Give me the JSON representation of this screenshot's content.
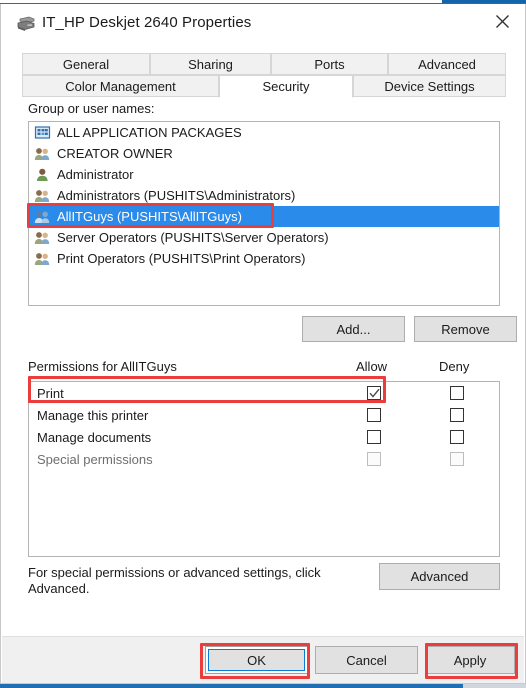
{
  "window": {
    "title": "IT_HP Deskjet 2640 Properties",
    "icon": "printer-icon",
    "close_label": "✕"
  },
  "tabs": {
    "row1": [
      {
        "label": "General",
        "active": false
      },
      {
        "label": "Sharing",
        "active": false
      },
      {
        "label": "Ports",
        "active": false
      },
      {
        "label": "Advanced",
        "active": false
      }
    ],
    "row2": [
      {
        "label": "Color Management",
        "active": false
      },
      {
        "label": "Security",
        "active": true
      },
      {
        "label": "Device Settings",
        "active": false
      }
    ]
  },
  "security": {
    "group_label": "Group or user names:",
    "groups": [
      {
        "name": "ALL APPLICATION PACKAGES",
        "icon": "application-packages-icon",
        "selected": false
      },
      {
        "name": "CREATOR OWNER",
        "icon": "group-icon",
        "selected": false
      },
      {
        "name": "Administrator",
        "icon": "user-icon",
        "selected": false
      },
      {
        "name": "Administrators (PUSHITS\\Administrators)",
        "icon": "group-icon",
        "selected": false
      },
      {
        "name": "AllITGuys (PUSHITS\\AllITGuys)",
        "icon": "group-icon",
        "selected": true
      },
      {
        "name": "Server Operators (PUSHITS\\Server Operators)",
        "icon": "group-icon",
        "selected": false
      },
      {
        "name": "Print Operators (PUSHITS\\Print Operators)",
        "icon": "group-icon",
        "selected": false
      }
    ],
    "add_label": "Add...",
    "remove_label": "Remove",
    "permissions_label": "Permissions for AllITGuys",
    "allow_header": "Allow",
    "deny_header": "Deny",
    "permissions": [
      {
        "name": "Print",
        "allow": true,
        "deny": false,
        "disabled": false
      },
      {
        "name": "Manage this printer",
        "allow": false,
        "deny": false,
        "disabled": false
      },
      {
        "name": "Manage documents",
        "allow": false,
        "deny": false,
        "disabled": false
      },
      {
        "name": "Special permissions",
        "allow": false,
        "deny": false,
        "disabled": true
      }
    ],
    "helper_text": "For special permissions or advanced settings, click Advanced.",
    "advanced_label": "Advanced"
  },
  "footer": {
    "ok_label": "OK",
    "cancel_label": "Cancel",
    "apply_label": "Apply"
  },
  "colors": {
    "selection_blue": "#2a8bea",
    "annotation_red": "#ec3d3d",
    "focus_blue": "#0a7cd4"
  }
}
